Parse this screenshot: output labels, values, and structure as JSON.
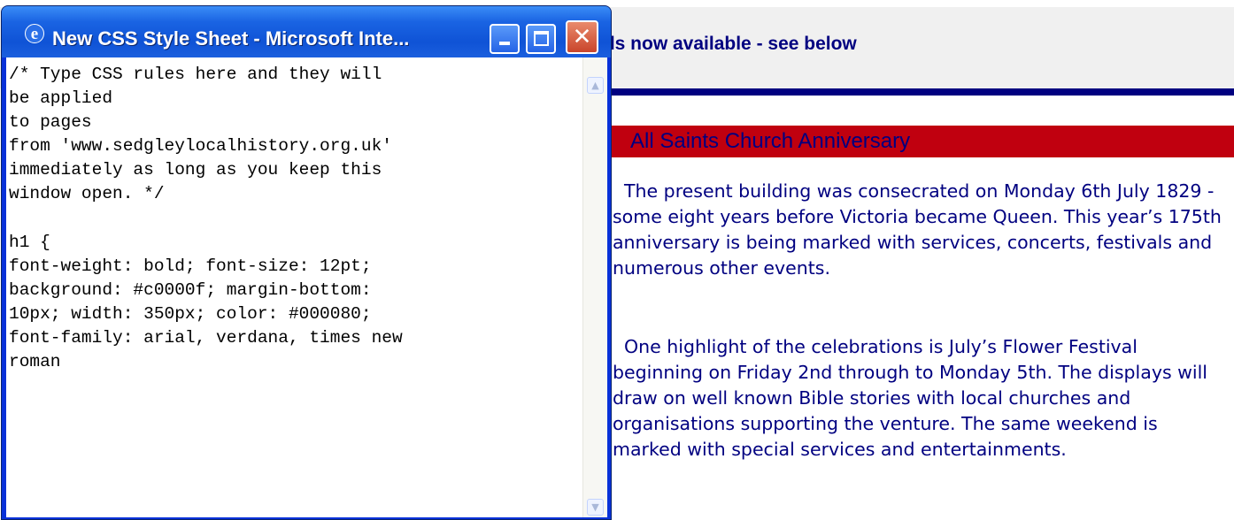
{
  "page": {
    "banner_text": "ils now available - see below",
    "section_heading": "All Saints Church Anniversary",
    "paragraphs": [
      "  The present building was consecrated on Monday 6th July 1829 - some eight years before Victoria became Queen. This year’s 175th anniversary is being marked with services, concerts, festivals and numerous other events.",
      "  One highlight of the celebrations is July’s Flower Festival beginning on Friday 2nd through to Monday 5th. The displays will draw on well known Bible stories with local churches and organisations supporting the venture. The same weekend is marked with special services and entertainments."
    ]
  },
  "popup": {
    "title": "New CSS Style Sheet - Microsoft Inte...",
    "icon": "ie-logo-icon",
    "buttons": {
      "minimize": "minimize-icon",
      "maximize": "maximize-icon",
      "close_glyph": "✕"
    },
    "editor_text": "/* Type CSS rules here and they will\nbe applied\nto pages\nfrom 'www.sedgleylocalhistory.org.uk'\nimmediately as long as you keep this\nwindow open. */\n\nh1 {\nfont-weight: bold; font-size: 12pt;\nbackground: #c0000f; margin-bottom:\n10px; width: 350px; color: #000080;\nfont-family: arial, verdana, times new\nroman",
    "scroll_up_glyph": "▲",
    "scroll_down_glyph": "▼"
  },
  "colors": {
    "heading_bg": "#c0000f",
    "heading_text": "#000080",
    "body_text": "#000080",
    "titlebar": "#0f53d6"
  }
}
